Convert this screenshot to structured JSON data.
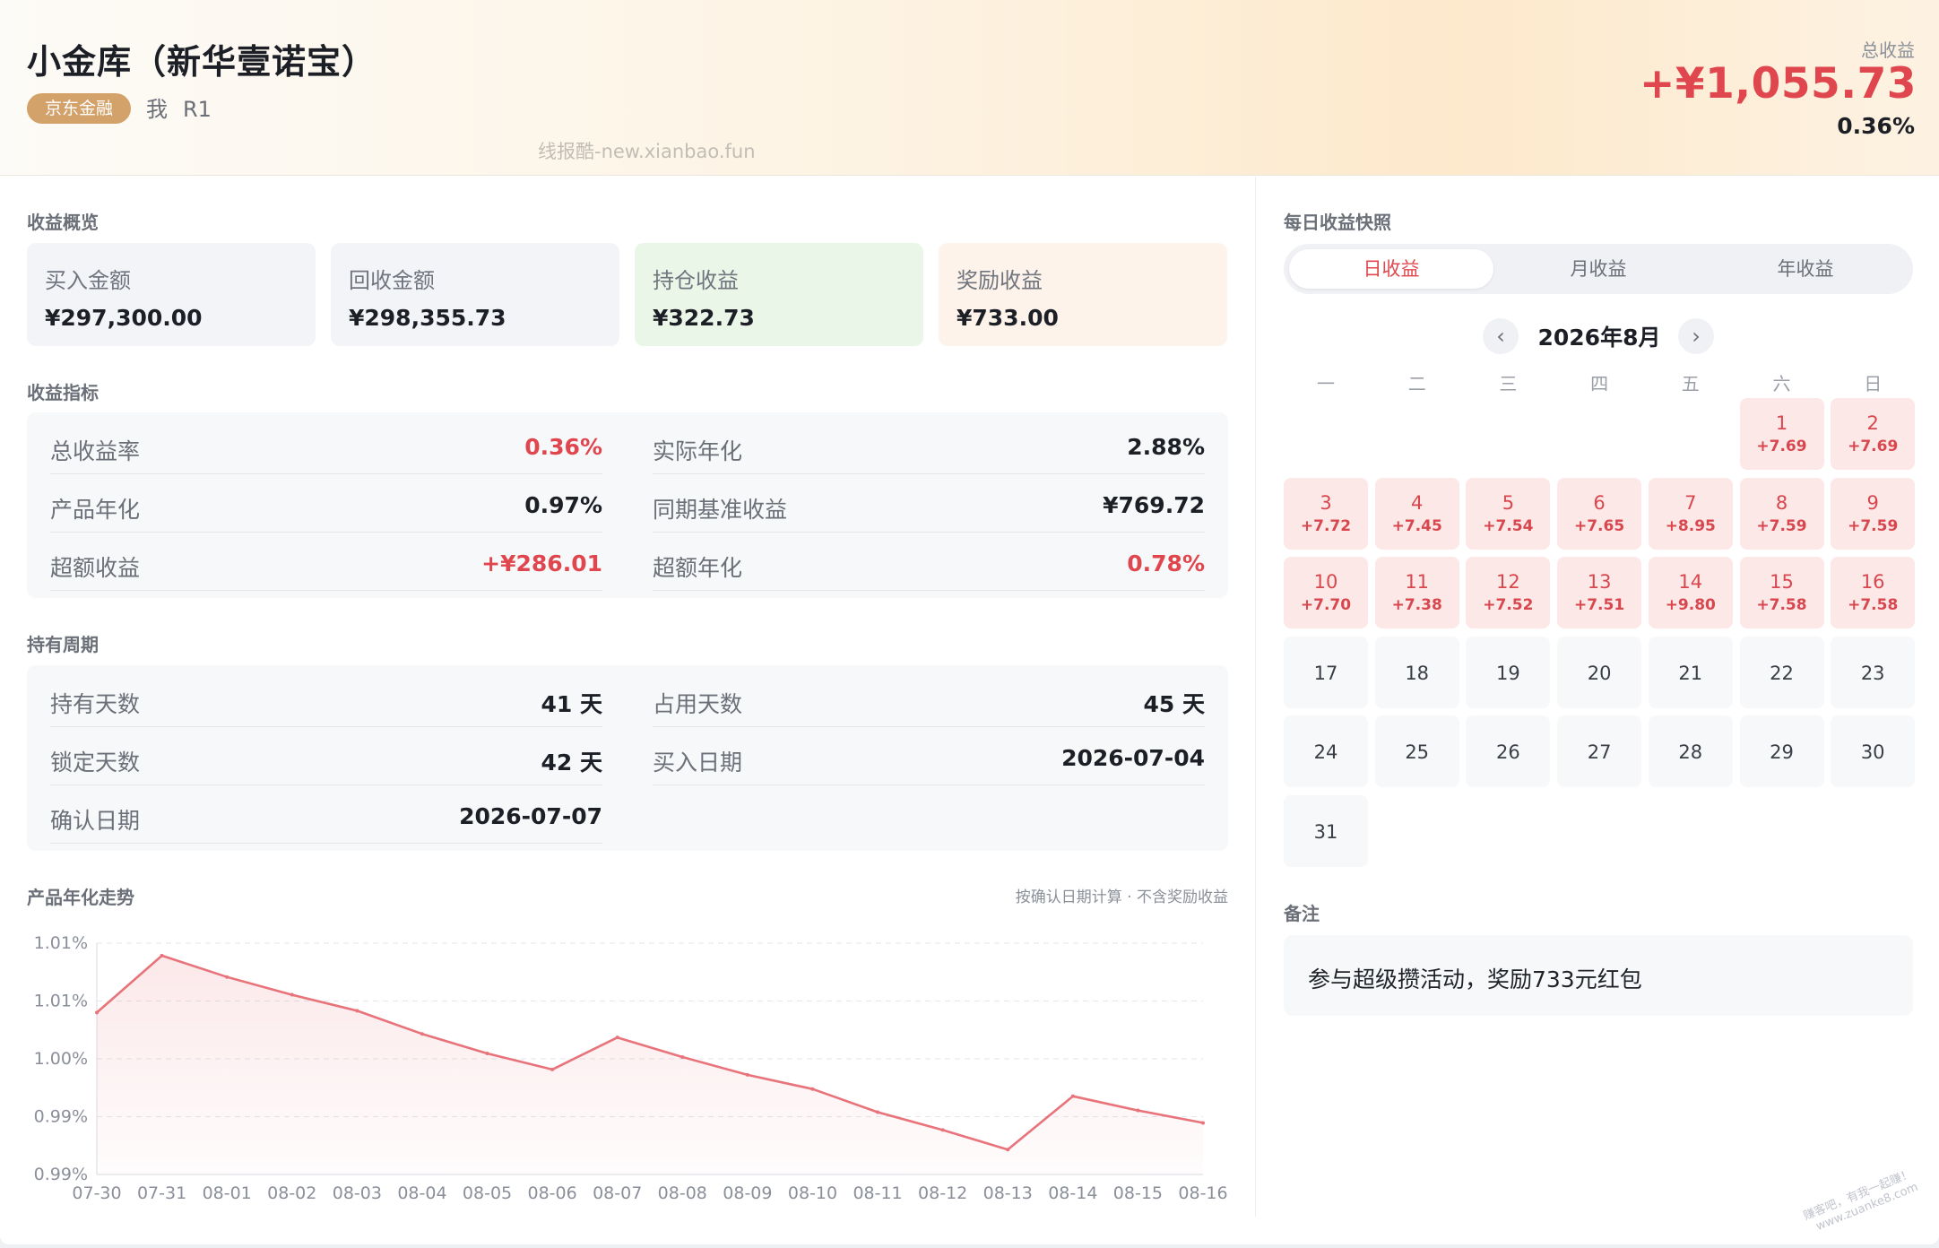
{
  "header": {
    "title": "小金库（新华壹诺宝）",
    "platform_tag": "京东金融",
    "owner": "我",
    "risk_level": "R1",
    "watermark": "线报酷-new.xianbao.fun",
    "total_label": "总收益",
    "total_value": "+¥1,055.73",
    "total_rate": "0.36%"
  },
  "overview": {
    "title": "收益概览",
    "cards": [
      {
        "label": "买入金额",
        "value": "¥297,300.00",
        "tone": "gray"
      },
      {
        "label": "回收金额",
        "value": "¥298,355.73",
        "tone": "gray"
      },
      {
        "label": "持仓收益",
        "value": "¥322.73",
        "tone": "green"
      },
      {
        "label": "奖励收益",
        "value": "¥733.00",
        "tone": "peach"
      }
    ]
  },
  "metrics": {
    "title": "收益指标",
    "items": [
      {
        "label": "总收益率",
        "value": "0.36%",
        "red": true
      },
      {
        "label": "实际年化",
        "value": "2.88%",
        "red": false
      },
      {
        "label": "产品年化",
        "value": "0.97%",
        "red": false
      },
      {
        "label": "同期基准收益",
        "value": "¥769.72",
        "red": false
      },
      {
        "label": "超额收益",
        "value": "+¥286.01",
        "red": true
      },
      {
        "label": "超额年化",
        "value": "0.78%",
        "red": true
      }
    ]
  },
  "holding": {
    "title": "持有周期",
    "items": [
      {
        "label": "持有天数",
        "value": "41 天"
      },
      {
        "label": "占用天数",
        "value": "45 天"
      },
      {
        "label": "锁定天数",
        "value": "42 天"
      },
      {
        "label": "买入日期",
        "value": "2026-07-04"
      },
      {
        "label": "确认日期",
        "value": "2026-07-07"
      }
    ]
  },
  "trend": {
    "title": "产品年化走势",
    "note": "按确认日期计算 · 不含奖励收益"
  },
  "chart_data": {
    "type": "area",
    "title": "产品年化走势",
    "x": [
      "07-30",
      "07-31",
      "08-01",
      "08-02",
      "08-03",
      "08-04",
      "08-05",
      "08-06",
      "08-07",
      "08-08",
      "08-09",
      "08-10",
      "08-11",
      "08-12",
      "08-13",
      "08-14",
      "08-15",
      "08-16"
    ],
    "series": [
      {
        "values": [
          1.0084,
          1.0116,
          1.0104,
          1.0094,
          1.0085,
          1.0072,
          1.0061,
          1.0052,
          1.007,
          1.0059,
          1.0049,
          1.0041,
          1.0028,
          1.0018,
          1.0007,
          1.0037,
          1.0029,
          1.0022
        ]
      }
    ],
    "y_ticks": [
      "1.01%",
      "1.01%",
      "1.00%",
      "0.99%",
      "0.99%"
    ],
    "ylim": [
      0.9993,
      1.0123
    ],
    "grid": true,
    "color": "#e8737a"
  },
  "snapshot": {
    "title": "每日收益快照",
    "tabs": [
      "日收益",
      "月收益",
      "年收益"
    ],
    "active_tab": 0,
    "month_label": "2026年8月",
    "prev": "‹",
    "next": "›",
    "weekdays": [
      "一",
      "二",
      "三",
      "四",
      "五",
      "六",
      "日"
    ],
    "first_weekday_index": 5,
    "days": [
      {
        "d": "1",
        "amt": "+7.69"
      },
      {
        "d": "2",
        "amt": "+7.69"
      },
      {
        "d": "3",
        "amt": "+7.72"
      },
      {
        "d": "4",
        "amt": "+7.45"
      },
      {
        "d": "5",
        "amt": "+7.54"
      },
      {
        "d": "6",
        "amt": "+7.65"
      },
      {
        "d": "7",
        "amt": "+8.95"
      },
      {
        "d": "8",
        "amt": "+7.59"
      },
      {
        "d": "9",
        "amt": "+7.59"
      },
      {
        "d": "10",
        "amt": "+7.70"
      },
      {
        "d": "11",
        "amt": "+7.38"
      },
      {
        "d": "12",
        "amt": "+7.52"
      },
      {
        "d": "13",
        "amt": "+7.51"
      },
      {
        "d": "14",
        "amt": "+9.80"
      },
      {
        "d": "15",
        "amt": "+7.58"
      },
      {
        "d": "16",
        "amt": "+7.58"
      },
      {
        "d": "17",
        "amt": ""
      },
      {
        "d": "18",
        "amt": ""
      },
      {
        "d": "19",
        "amt": ""
      },
      {
        "d": "20",
        "amt": ""
      },
      {
        "d": "21",
        "amt": ""
      },
      {
        "d": "22",
        "amt": ""
      },
      {
        "d": "23",
        "amt": ""
      },
      {
        "d": "24",
        "amt": ""
      },
      {
        "d": "25",
        "amt": ""
      },
      {
        "d": "26",
        "amt": ""
      },
      {
        "d": "27",
        "amt": ""
      },
      {
        "d": "28",
        "amt": ""
      },
      {
        "d": "29",
        "amt": ""
      },
      {
        "d": "30",
        "amt": ""
      },
      {
        "d": "31",
        "amt": ""
      }
    ]
  },
  "notes": {
    "title": "备注",
    "text": "参与超级攒活动，奖励733元红包"
  },
  "corner_watermark": [
    "赚客吧，有我一起赚！",
    "www.zuanke8.com"
  ]
}
